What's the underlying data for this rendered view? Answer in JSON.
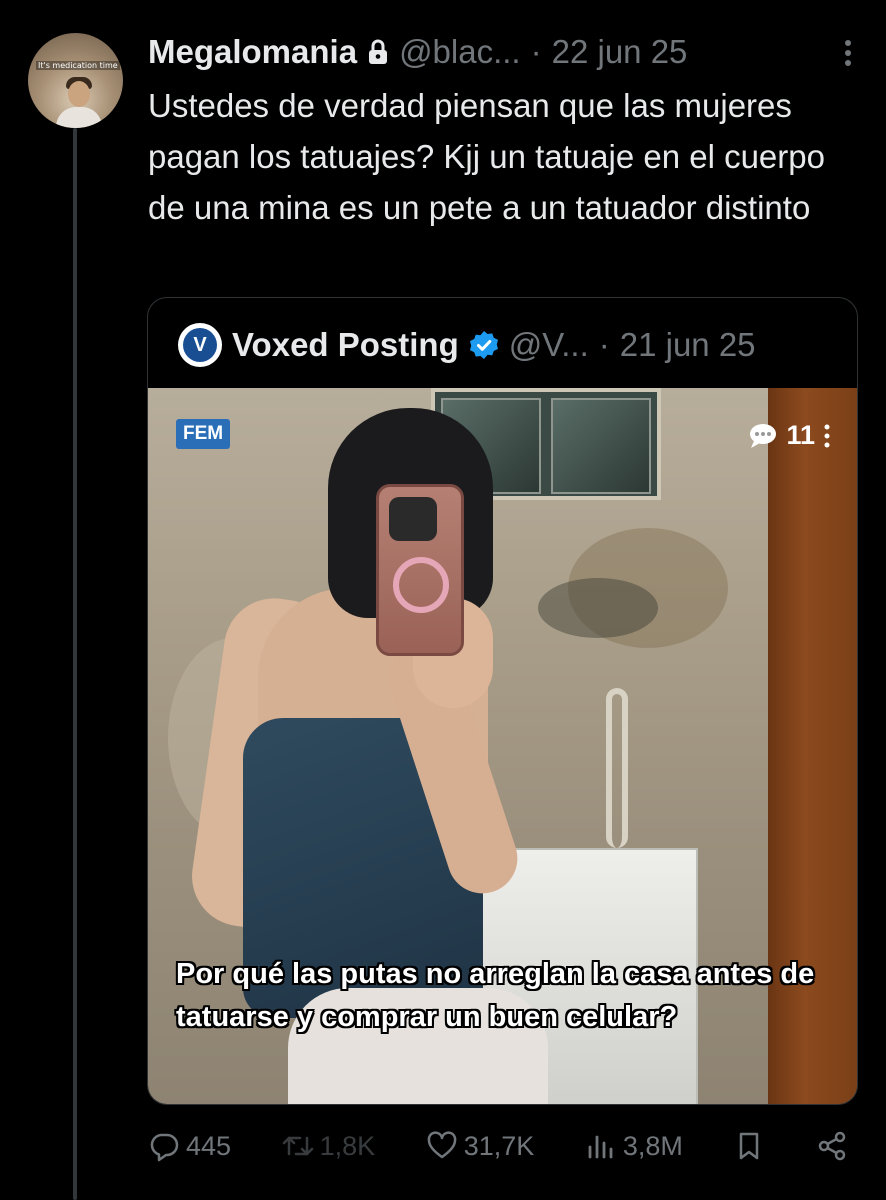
{
  "author": {
    "avatar_caption": "It's medication time",
    "name": "Megalomania",
    "handle": "@blac...",
    "separator": "·",
    "date": "22 jun 25",
    "locked_icon": "lock-icon"
  },
  "tweet": {
    "text": "Ustedes de verdad piensan que las mujeres pagan los tatuajes? Kjj un tatuaje en el cuerpo de una mina es un pete a un tatuador distinto"
  },
  "quote": {
    "avatar_letter": "V",
    "name": "Voxed Posting",
    "handle": "@V...",
    "separator": "·",
    "date": "21 jun 25",
    "verified_icon": "verified-badge-icon",
    "media": {
      "badge": "FEM",
      "comment_count": "11",
      "caption": "Por qué las putas no arreglan la casa antes de tatuarse y comprar un buen celular?"
    }
  },
  "actions": {
    "replies": "445",
    "reposts": "1,8K",
    "likes": "31,7K",
    "views": "3,8M"
  },
  "colors": {
    "background": "#000000",
    "text": "#e7e9ea",
    "muted": "#71767b",
    "border": "#2f3336",
    "verified": "#1d9bf0",
    "badge": "#2a6eb8"
  }
}
